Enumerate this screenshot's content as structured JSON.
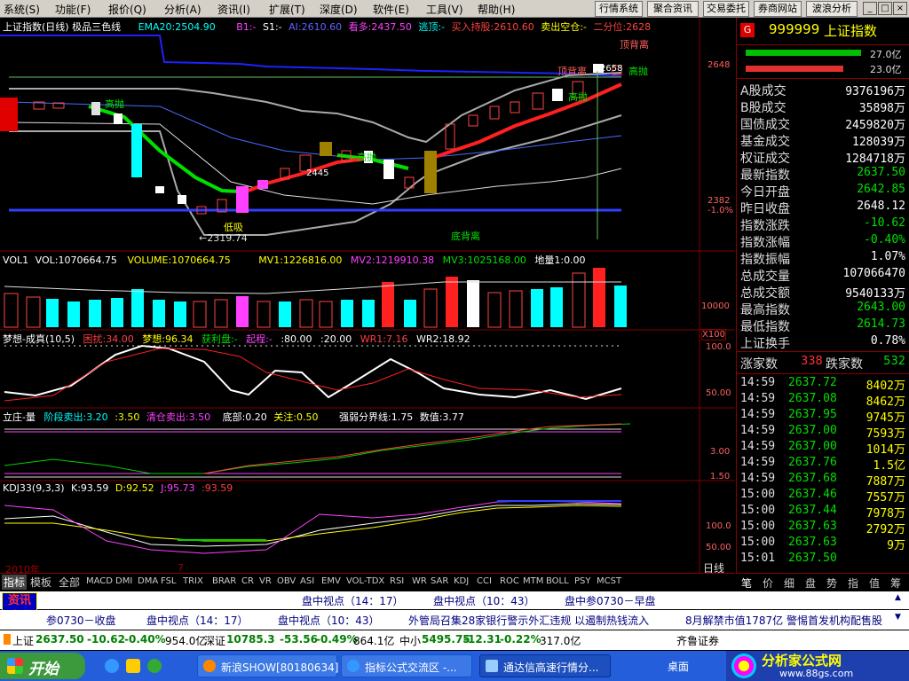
{
  "menu": [
    "系统(S)",
    "功能(F)",
    "报价(Q)",
    "分析(A)",
    "资讯(I)",
    "扩展(T)",
    "深度(D)",
    "软件(E)",
    "工具(V)",
    "帮助(H)"
  ],
  "right_buttons": [
    "行情系统",
    "聚合资讯",
    "交易委托",
    "券商网站",
    "波浪分析"
  ],
  "window_controls": [
    "_",
    "□",
    "×"
  ],
  "main_title": {
    "name": "上证指数(日线) 极品三色线",
    "ema": "EMA20:2504.90",
    "b1": "B1:-",
    "s1": "S1:-",
    "ai": "AI:2610.60",
    "kanduo": "看多:2437.50",
    "taoding": "逃顶:-",
    "mairu": "买入持股:2610.60",
    "maichu": "卖出空仓:-",
    "erfen": "二分位:2628"
  },
  "main_labels": {
    "dingbeili1": "顶背离",
    "dingbeili2": "顶背离",
    "dibeili": "底背离",
    "gaopao1": "高抛",
    "gaopao2": "高抛",
    "gaopao3": "高抛",
    "gaopao4": "高抛",
    "dixi": "低吸",
    "low": "←2319.74",
    "mid": "2445",
    "peak": "2658",
    "y1": "2648",
    "y2": "2382",
    "y3": "-1.0%"
  },
  "vol": {
    "title": "VOL1",
    "vol": "VOL:1070664.75",
    "volume": "VOLUME:1070664.75",
    "mv1": "MV1:1226816.00",
    "mv2": "MV2:1219910.38",
    "mv3": "MV3:1025168.00",
    "scale": "地量1:0.00",
    "y1": "10000",
    "y2": "X100"
  },
  "dream": {
    "title": "梦想-成真(10,5)",
    "kun": "困扰:34.00",
    "mx": "梦想:96.34",
    "hl": "获利盘:-",
    "qc": "起程:-",
    "v80": ":80.00",
    "v20": ":20.00",
    "wr1": "WR1:7.16",
    "wr2": "WR2:18.92",
    "y1": "100.0",
    "y2": "50.00"
  },
  "lizhuang": {
    "title": "立庄-量",
    "jd": "阶段卖出:3.20",
    "v350": ":3.50",
    "qc": "清仓卖出:3.50",
    "db": "底部:0.20",
    "gz": "关注:0.50",
    "qr": "强弱分界线:1.75",
    "sz": "数值:3.77",
    "y1": "3.00",
    "y2": "1.50"
  },
  "kdj": {
    "title": "KDJ33(9,3,3)",
    "k": "K:93.59",
    "d": "D:92.52",
    "j": "J:95.73",
    "x": ":93.59",
    "y1": "100.0",
    "y2": "50.00",
    "year": "2010年",
    "m": "7"
  },
  "period": "日线",
  "indicator_tabs": [
    "指标",
    "模板",
    "全部",
    "MACD",
    "DMI",
    "DMA",
    "FSL",
    "TRIX",
    "BRAR",
    "CR",
    "VR",
    "OBV",
    "ASI",
    "EMV",
    "VOL-TDX",
    "RSI",
    "WR",
    "SAR",
    "KDJ",
    "CCI",
    "ROC",
    "MTM",
    "BOLL",
    "PSY",
    "MCST"
  ],
  "quote": {
    "g": "G",
    "code": "999999",
    "name": "上证指数",
    "bar1": "27.0亿",
    "bar2": "23.0亿",
    "rows": [
      {
        "l": "A股成交",
        "v": "9376196万",
        "c": "#ffffff"
      },
      {
        "l": "B股成交",
        "v": "35898万",
        "c": "#ffffff"
      },
      {
        "l": "国债成交",
        "v": "2459820万",
        "c": "#ffffff"
      },
      {
        "l": "基金成交",
        "v": "128039万",
        "c": "#ffffff"
      },
      {
        "l": "权证成交",
        "v": "1284718万",
        "c": "#ffffff"
      },
      {
        "l": "最新指数",
        "v": "2637.50",
        "c": "#00e000"
      },
      {
        "l": "今日开盘",
        "v": "2642.85",
        "c": "#00e000"
      },
      {
        "l": "昨日收盘",
        "v": "2648.12",
        "c": "#ffffff"
      },
      {
        "l": "指数涨跌",
        "v": "-10.62",
        "c": "#00e000"
      },
      {
        "l": "指数涨幅",
        "v": "-0.40%",
        "c": "#00e000"
      },
      {
        "l": "指数振幅",
        "v": "1.07%",
        "c": "#ffffff"
      },
      {
        "l": "总成交量",
        "v": "107066470",
        "c": "#ffffff"
      },
      {
        "l": "总成交额",
        "v": "9540133万",
        "c": "#ffffff"
      },
      {
        "l": "最高指数",
        "v": "2643.00",
        "c": "#00e000"
      },
      {
        "l": "最低指数",
        "v": "2614.73",
        "c": "#00e000"
      },
      {
        "l": "上证换手",
        "v": "0.78%",
        "c": "#ffffff"
      }
    ],
    "zj_label": "涨家数",
    "zj": "338",
    "dj_label": "跌家数",
    "dj": "532",
    "ticks": [
      {
        "t": "14:59",
        "p": "2637.72",
        "v": "8402万"
      },
      {
        "t": "14:59",
        "p": "2637.08",
        "v": "8462万"
      },
      {
        "t": "14:59",
        "p": "2637.95",
        "v": "9745万"
      },
      {
        "t": "14:59",
        "p": "2637.00",
        "v": "7593万"
      },
      {
        "t": "14:59",
        "p": "2637.00",
        "v": "1014万"
      },
      {
        "t": "14:59",
        "p": "2637.76",
        "v": "1.5亿"
      },
      {
        "t": "14:59",
        "p": "2637.68",
        "v": "7887万"
      },
      {
        "t": "15:00",
        "p": "2637.46",
        "v": "7557万"
      },
      {
        "t": "15:00",
        "p": "2637.44",
        "v": "7978万"
      },
      {
        "t": "15:00",
        "p": "2637.63",
        "v": "2792万"
      },
      {
        "t": "15:00",
        "p": "2637.63",
        "v": "9万"
      },
      {
        "t": "15:01",
        "p": "2637.50",
        "v": ""
      }
    ],
    "tabs": [
      "笔",
      "价",
      "细",
      "盘",
      "势",
      "指",
      "值",
      "筹"
    ]
  },
  "ticker1": {
    "badge": "资讯速递",
    "items": [
      "盘中视点（14：17）",
      "盘中视点（10：43）",
      "盘中参0730－早盘"
    ]
  },
  "ticker2": {
    "items": [
      "参0730－收盘",
      "盘中视点（14：17）",
      "盘中视点（10：43）",
      "外管局召集28家银行警示外汇违规 以遏制热钱流入",
      "8月解禁市值1787亿 警惕首发机构配售股"
    ]
  },
  "ticker3": {
    "sh_name": "上证",
    "sh_price": "2637.50",
    "sh_chg": "-10.62",
    "sh_pct": "-0.40%",
    "sh_amt": "954.0亿",
    "sz_name": "深证",
    "sz_price": "10785.3",
    "sz_chg": "-53.56",
    "sz_pct": "-0.49%",
    "sz_amt": "864.1亿",
    "zx_name": "中小",
    "zx_price": "5495.75",
    "zx_chg": "-12.31",
    "zx_pct": "-0.22%",
    "zx_amt": "317.0亿",
    "broker": "齐鲁证券"
  },
  "taskbar": {
    "start": "开始",
    "tasks": [
      "新浪SHOW[80180634]",
      "指标公式交流区 -...",
      "通达信高速行情分..."
    ],
    "desk": "桌面",
    "brand": "分析家公式网",
    "url": "www.88gs.com"
  }
}
